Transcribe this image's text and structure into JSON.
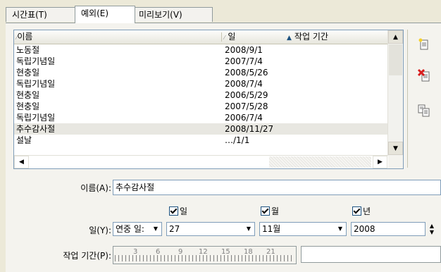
{
  "tabs": [
    {
      "label": "시간표(T)"
    },
    {
      "label": "예외(E)"
    },
    {
      "label": "미리보기(V)"
    }
  ],
  "list": {
    "columns": [
      "이름",
      "일",
      "작업 기간"
    ],
    "rows": [
      {
        "name": "노동절",
        "date": "2008/9/1"
      },
      {
        "name": "독립기념일",
        "date": "2007/7/4"
      },
      {
        "name": "현충일",
        "date": "2008/5/26"
      },
      {
        "name": "독립기념일",
        "date": "2008/7/4"
      },
      {
        "name": "현충일",
        "date": "2006/5/29"
      },
      {
        "name": "현충일",
        "date": "2007/5/28"
      },
      {
        "name": "독립기념일",
        "date": "2006/7/4"
      },
      {
        "name": "추수감사절",
        "date": "2008/11/27"
      },
      {
        "name": "설날",
        "date": "…/1/1"
      }
    ]
  },
  "form": {
    "name_label": "이름(A):",
    "name_value": "추수감사절",
    "day_label": "일(Y):",
    "day_type": "연중 일:",
    "day_check": "일",
    "day_value": "27",
    "month_check": "월",
    "month_value": "11월",
    "year_check": "년",
    "year_value": "2008",
    "period_label": "작업 기간(P):",
    "ruler_numbers": [
      "3",
      "6",
      "9",
      "12",
      "15",
      "18",
      "21"
    ]
  },
  "icons": {
    "new": "new-document-icon",
    "delete": "delete-icon",
    "copy": "copy-icon"
  },
  "colors": {
    "delete_red": "#d81e1e",
    "selection_bg": "#e8e7e1"
  }
}
